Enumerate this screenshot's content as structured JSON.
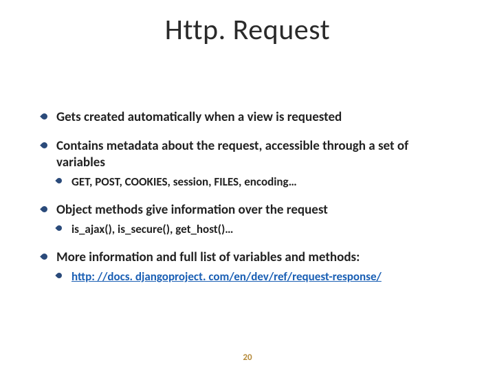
{
  "title": "Http. Request",
  "bullets": [
    {
      "level": 1,
      "text": "Gets created automatically when a view is requested"
    },
    {
      "level": 1,
      "text": "Contains metadata about the request, accessible through a set of variables",
      "tight": true
    },
    {
      "level": 2,
      "text": "GET, POST, COOKIES, session, FILES, encoding…"
    },
    {
      "level": 1,
      "text": "Object methods give information over the request",
      "tight": true
    },
    {
      "level": 2,
      "text": "is_ajax(), is_secure(), get_host()…"
    },
    {
      "level": 1,
      "text": "More information and full list of variables and methods:",
      "tight": true
    },
    {
      "level": 2,
      "link": true,
      "text": "http: //docs. djangoproject. com/en/dev/ref/request-response/"
    }
  ],
  "page_number": "20"
}
